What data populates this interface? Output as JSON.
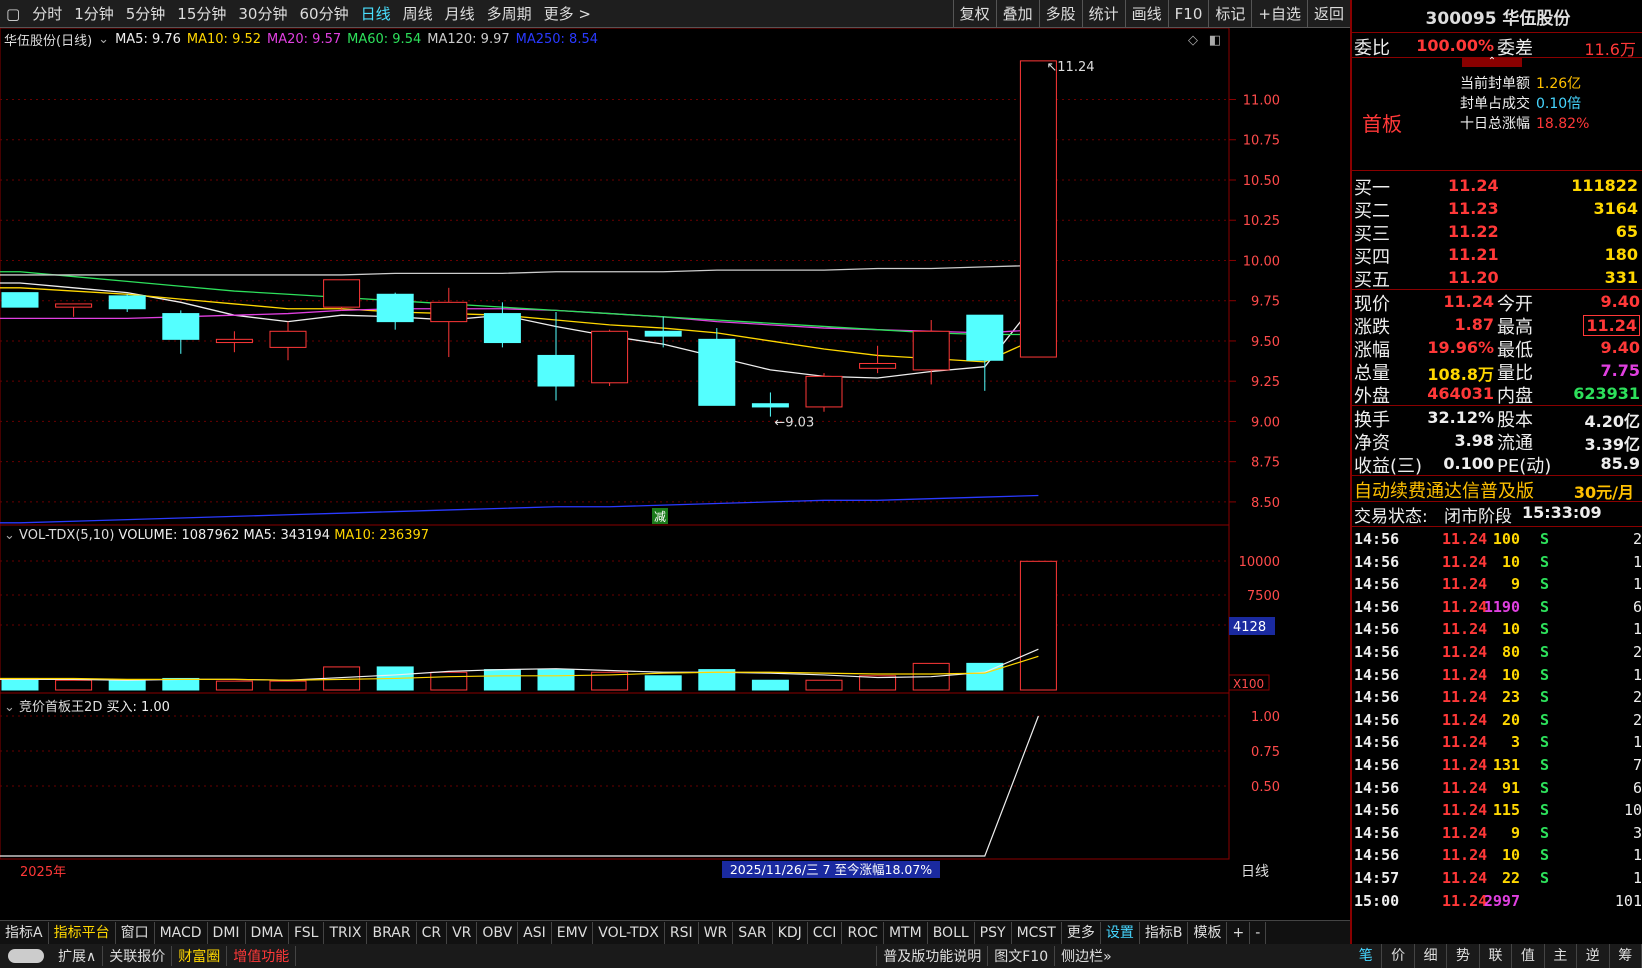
{
  "toolbar": {
    "left_icon": "▢",
    "periods": [
      "分时",
      "1分钟",
      "5分钟",
      "15分钟",
      "30分钟",
      "60分钟",
      "日线",
      "周线",
      "月线",
      "多周期",
      "更多 >"
    ],
    "active_index": 6,
    "right": [
      "复权",
      "叠加",
      "多股",
      "统计",
      "画线",
      "F10",
      "标记",
      "+自选",
      "返回"
    ]
  },
  "stock": {
    "code_name": "300095 华伍股份"
  },
  "main_legend": {
    "title": "华伍股份(日线)",
    "items": [
      {
        "label": "MA5: 9.76",
        "color": "#eeeeee"
      },
      {
        "label": "MA10: 9.52",
        "color": "#ffd700"
      },
      {
        "label": "MA20: 9.57",
        "color": "#e040e0"
      },
      {
        "label": "MA60: 9.54",
        "color": "#2de05b"
      },
      {
        "label": "MA120: 9.97",
        "color": "#cccccc"
      },
      {
        "label": "MA250: 8.54",
        "color": "#2a3aff"
      }
    ]
  },
  "main_axis": [
    "11.00",
    "10.75",
    "10.50",
    "10.25",
    "10.00",
    "9.75",
    "9.50",
    "9.25",
    "9.00",
    "8.75",
    "8.50"
  ],
  "annotations": {
    "high": "11.24",
    "low": "9.03",
    "tag": "减"
  },
  "vol_legend": {
    "title": "VOL-TDX(5,10)",
    "volume": "VOLUME: 1087962",
    "ma5": "MA5: 343194",
    "ma10": "MA10: 236397"
  },
  "vol_axis": [
    "10000",
    "7500"
  ],
  "vol_cursor": "4128",
  "vol_unit": "X100",
  "ind_legend": {
    "title": "竞价首板王2D",
    "value": "买入: 1.00"
  },
  "ind_axis": [
    "1.00",
    "0.75",
    "0.50"
  ],
  "bottom_info": {
    "year": "2025年",
    "range": "2025/11/26/三 7 至今涨幅18.07%",
    "period": "日线"
  },
  "chart_data": {
    "type": "candlestick",
    "candles": [
      {
        "o": 9.8,
        "c": 9.71,
        "h": 9.8,
        "l": 9.71
      },
      {
        "o": 9.71,
        "c": 9.73,
        "h": 9.73,
        "l": 9.65
      },
      {
        "o": 9.78,
        "c": 9.7,
        "h": 9.79,
        "l": 9.68
      },
      {
        "o": 9.67,
        "c": 9.51,
        "h": 9.69,
        "l": 9.42
      },
      {
        "o": 9.49,
        "c": 9.51,
        "h": 9.56,
        "l": 9.43
      },
      {
        "o": 9.46,
        "c": 9.56,
        "h": 9.62,
        "l": 9.38
      },
      {
        "o": 9.71,
        "c": 9.88,
        "h": 9.88,
        "l": 9.69
      },
      {
        "o": 9.79,
        "c": 9.62,
        "h": 9.8,
        "l": 9.57
      },
      {
        "o": 9.62,
        "c": 9.74,
        "h": 9.83,
        "l": 9.4
      },
      {
        "o": 9.67,
        "c": 9.49,
        "h": 9.74,
        "l": 9.46
      },
      {
        "o": 9.41,
        "c": 9.22,
        "h": 9.68,
        "l": 9.13
      },
      {
        "o": 9.24,
        "c": 9.56,
        "h": 9.57,
        "l": 9.22
      },
      {
        "o": 9.56,
        "c": 9.53,
        "h": 9.65,
        "l": 9.46
      },
      {
        "o": 9.51,
        "c": 9.1,
        "h": 9.58,
        "l": 9.1
      },
      {
        "o": 9.11,
        "c": 9.09,
        "h": 9.18,
        "l": 9.03
      },
      {
        "o": 9.09,
        "c": 9.28,
        "h": 9.3,
        "l": 9.06
      },
      {
        "o": 9.33,
        "c": 9.36,
        "h": 9.47,
        "l": 9.3
      },
      {
        "o": 9.32,
        "c": 9.56,
        "h": 9.63,
        "l": 9.23
      },
      {
        "o": 9.66,
        "c": 9.38,
        "h": 9.66,
        "l": 9.19
      },
      {
        "o": 9.4,
        "c": 11.24,
        "h": 11.24,
        "l": 9.4
      }
    ],
    "volumes": [
      13,
      11,
      11,
      13,
      10,
      10,
      26,
      26,
      20,
      23,
      23,
      20,
      16,
      23,
      11,
      11,
      16,
      30,
      30,
      145
    ],
    "ma": [
      {
        "name": "MA5",
        "color": "#eeeeee",
        "values": [
          9.86,
          9.83,
          9.8,
          9.74,
          9.66,
          9.62,
          9.66,
          9.65,
          9.63,
          9.66,
          9.59,
          9.53,
          9.48,
          9.4,
          9.32,
          9.28,
          9.27,
          9.31,
          9.34,
          9.76
        ]
      },
      {
        "name": "MA10",
        "color": "#ffd700",
        "values": [
          9.83,
          9.81,
          9.79,
          9.76,
          9.73,
          9.7,
          9.7,
          9.68,
          9.67,
          9.66,
          9.63,
          9.6,
          9.58,
          9.55,
          9.5,
          9.45,
          9.41,
          9.39,
          9.37,
          9.52
        ]
      },
      {
        "name": "MA20",
        "color": "#e040e0",
        "values": [
          9.64,
          9.64,
          9.64,
          9.65,
          9.66,
          9.67,
          9.69,
          9.7,
          9.7,
          9.7,
          9.69,
          9.67,
          9.65,
          9.62,
          9.6,
          9.58,
          9.57,
          9.56,
          9.55,
          9.57
        ]
      },
      {
        "name": "MA60",
        "color": "#2de05b",
        "values": [
          9.93,
          9.9,
          9.87,
          9.84,
          9.81,
          9.79,
          9.77,
          9.75,
          9.73,
          9.71,
          9.69,
          9.67,
          9.65,
          9.63,
          9.61,
          9.59,
          9.57,
          9.55,
          9.54,
          9.54
        ]
      },
      {
        "name": "MA120",
        "color": "#cccccc",
        "values": [
          9.91,
          9.91,
          9.91,
          9.91,
          9.91,
          9.91,
          9.91,
          9.92,
          9.92,
          9.92,
          9.93,
          9.93,
          9.93,
          9.94,
          9.94,
          9.94,
          9.95,
          9.95,
          9.96,
          9.97
        ]
      },
      {
        "name": "MA250",
        "color": "#2a3aff",
        "values": [
          8.37,
          8.38,
          8.39,
          8.4,
          8.41,
          8.42,
          8.43,
          8.44,
          8.45,
          8.46,
          8.47,
          8.47,
          8.48,
          8.49,
          8.5,
          8.51,
          8.51,
          8.52,
          8.53,
          8.54
        ]
      }
    ],
    "vol_ma": [
      {
        "name": "MA5",
        "color": "#eeeeee",
        "values": [
          12,
          12,
          11,
          12,
          12,
          11,
          14,
          17,
          21,
          23,
          24,
          22,
          20,
          20,
          19,
          17,
          14,
          15,
          20,
          343194
        ]
      },
      {
        "name": "MA10",
        "color": "#ffd700",
        "values": [
          13,
          13,
          12,
          12,
          12,
          11,
          12,
          13,
          15,
          16,
          16,
          17,
          19,
          20,
          20,
          19,
          18,
          18,
          19,
          236397
        ]
      }
    ],
    "indicator": [
      0,
      0,
      0,
      0,
      0,
      0,
      0,
      0,
      0,
      0,
      0,
      0,
      0,
      0,
      0,
      0,
      0,
      0,
      0,
      1
    ]
  },
  "right": {
    "wei": {
      "l1": "委比",
      "v1": "100.00%",
      "l2": "委差",
      "v2": "11.6万"
    },
    "board": {
      "label": "首板",
      "items": [
        {
          "k": "当前封单额",
          "v": "1.26亿"
        },
        {
          "k": "封单占成交",
          "v": "0.10倍"
        },
        {
          "k": "十日总涨幅",
          "v": "18.82%"
        }
      ]
    },
    "bids": [
      {
        "l": "买一",
        "p": "11.24",
        "v": "111822"
      },
      {
        "l": "买二",
        "p": "11.23",
        "v": "3164"
      },
      {
        "l": "买三",
        "p": "11.22",
        "v": "65"
      },
      {
        "l": "买四",
        "p": "11.21",
        "v": "180"
      },
      {
        "l": "买五",
        "p": "11.20",
        "v": "331"
      }
    ],
    "quote": [
      {
        "l1": "现价",
        "v1": "11.24",
        "l2": "今开",
        "v2": "9.40"
      },
      {
        "l1": "涨跌",
        "v1": "1.87",
        "l2": "最高",
        "v2": "11.24"
      },
      {
        "l1": "涨幅",
        "v1": "19.96%",
        "l2": "最低",
        "v2": "9.40"
      },
      {
        "l1": "总量",
        "v1": "108.8万",
        "l2": "量比",
        "v2": "7.75"
      },
      {
        "l1": "外盘",
        "v1": "464031",
        "l2": "内盘",
        "v2": "623931"
      }
    ],
    "fund": [
      {
        "l1": "换手",
        "v1": "32.12%",
        "l2": "股本",
        "v2": "4.20亿"
      },
      {
        "l1": "净资",
        "v1": "3.98",
        "l2": "流通",
        "v2": "3.39亿"
      },
      {
        "l1": "收益(三)",
        "v1": "0.100",
        "l2": "PE(动)",
        "v2": "85.9"
      }
    ],
    "promo": {
      "text": "自动续费通达信普及版",
      "price": "30元/月"
    },
    "state": {
      "label": "交易状态:",
      "value": "闭市阶段",
      "time": "15:33:09"
    },
    "ticks": [
      [
        "14:56",
        "11.24",
        "100",
        "S",
        "2"
      ],
      [
        "14:56",
        "11.24",
        "10",
        "S",
        "1"
      ],
      [
        "14:56",
        "11.24",
        "9",
        "S",
        "1"
      ],
      [
        "14:56",
        "11.24",
        "1190",
        "S",
        "6"
      ],
      [
        "14:56",
        "11.24",
        "10",
        "S",
        "1"
      ],
      [
        "14:56",
        "11.24",
        "80",
        "S",
        "2"
      ],
      [
        "14:56",
        "11.24",
        "10",
        "S",
        "1"
      ],
      [
        "14:56",
        "11.24",
        "23",
        "S",
        "2"
      ],
      [
        "14:56",
        "11.24",
        "20",
        "S",
        "2"
      ],
      [
        "14:56",
        "11.24",
        "3",
        "S",
        "1"
      ],
      [
        "14:56",
        "11.24",
        "131",
        "S",
        "7"
      ],
      [
        "14:56",
        "11.24",
        "91",
        "S",
        "6"
      ],
      [
        "14:56",
        "11.24",
        "115",
        "S",
        "10"
      ],
      [
        "14:56",
        "11.24",
        "9",
        "S",
        "3"
      ],
      [
        "14:56",
        "11.24",
        "10",
        "S",
        "1"
      ],
      [
        "14:57",
        "11.24",
        "22",
        "S",
        "1"
      ],
      [
        "15:00",
        "11.24",
        "2997",
        "",
        "101"
      ]
    ]
  },
  "bottom_tabs": [
    "指标A",
    "指标平台",
    "窗口",
    "MACD",
    "DMI",
    "DMA",
    "FSL",
    "TRIX",
    "BRAR",
    "CR",
    "VR",
    "OBV",
    "ASI",
    "EMV",
    "VOL-TDX",
    "RSI",
    "WR",
    "SAR",
    "KDJ",
    "CCI",
    "ROC",
    "MTM",
    "BOLL",
    "PSY",
    "MCST",
    "更多",
    "设置",
    "指标B",
    "模板",
    "+",
    "-"
  ],
  "status": [
    "扩展∧",
    "关联报价",
    "财富圈",
    "增值功能",
    "普及版功能说明",
    "图文F10",
    "侧边栏»"
  ],
  "nav": [
    "笔",
    "价",
    "细",
    "势",
    "联",
    "值",
    "主",
    "逆",
    "筹"
  ]
}
